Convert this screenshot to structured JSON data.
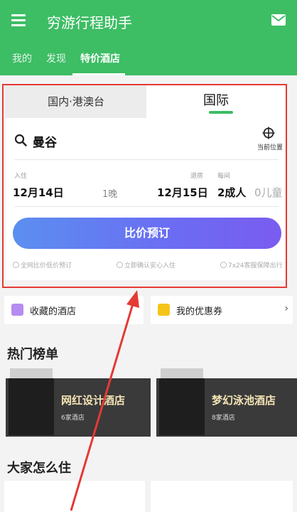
{
  "header": {
    "title": "穷游行程助手",
    "nav": [
      "我的",
      "发现",
      "特价酒店"
    ],
    "active_nav": "特价酒店"
  },
  "booking": {
    "tabs": [
      "国内·港澳台",
      "国际"
    ],
    "active_tab": "国际",
    "city": "曼谷",
    "location_label": "当前位置",
    "checkin_label": "入住",
    "checkout_label": "退房",
    "guests_label": "每间",
    "checkin_date": "12月14日",
    "nights": "1晚",
    "checkout_date": "12月15日",
    "adults": "2成人",
    "children": "0儿童",
    "book_button": "比价预订",
    "features": [
      "全网比价低价预订",
      "立即确认安心入住",
      "7x24客服保障出行"
    ]
  },
  "quick": {
    "favorites": "收藏的酒店",
    "coupons": "我的优惠券",
    "arrow": "›"
  },
  "hot": {
    "title": "热门榜单",
    "items": [
      {
        "title": "网红设计酒店",
        "count": "6家酒店"
      },
      {
        "title": "梦幻泳池酒店",
        "count": "8家酒店"
      }
    ]
  },
  "stay": {
    "title": "大家怎么住"
  },
  "colors": {
    "brand": "#3dbd64",
    "highlight": "#e53935",
    "button_start": "#5b8ff0",
    "button_end": "#7a5cf0"
  }
}
